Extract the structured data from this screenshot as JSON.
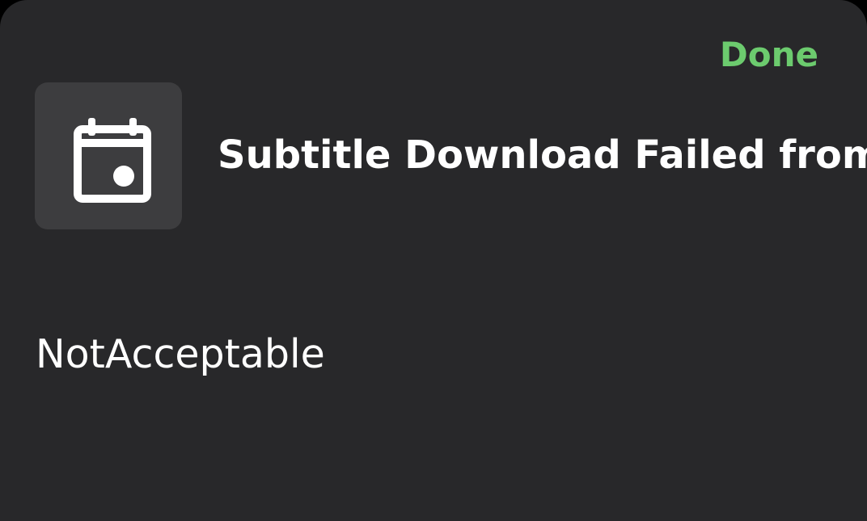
{
  "header": {
    "done_label": "Done",
    "accent_color": "#6ccb6e"
  },
  "notification": {
    "icon": "calendar-icon",
    "title": "Subtitle Download Failed from O",
    "message": "NotAcceptable"
  }
}
